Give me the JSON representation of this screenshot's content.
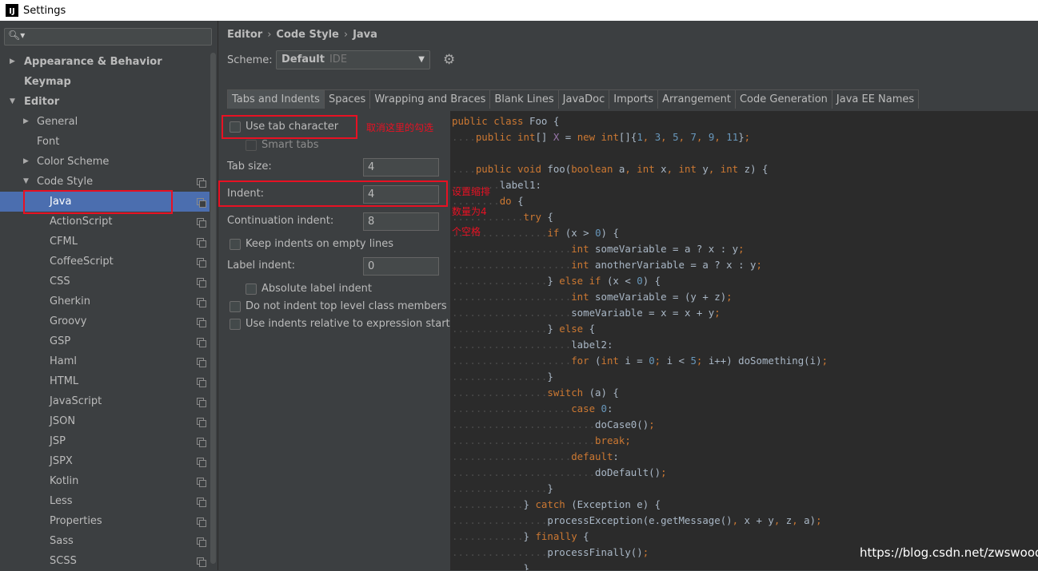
{
  "window": {
    "title": "Settings"
  },
  "search": {
    "placeholder": ""
  },
  "tree": [
    {
      "label": "Appearance & Behavior",
      "arrow": "▶",
      "level": 0,
      "bold": true
    },
    {
      "label": "Keymap",
      "arrow": "",
      "level": 0,
      "bold": true
    },
    {
      "label": "Editor",
      "arrow": "▼",
      "level": 0,
      "bold": true
    },
    {
      "label": "General",
      "arrow": "▶",
      "level": 1
    },
    {
      "label": "Font",
      "arrow": "",
      "level": 1
    },
    {
      "label": "Color Scheme",
      "arrow": "▶",
      "level": 1
    },
    {
      "label": "Code Style",
      "arrow": "▼",
      "level": 1,
      "copy": true
    },
    {
      "label": "Java",
      "arrow": "",
      "level": 2,
      "copy": true,
      "selected": true
    },
    {
      "label": "ActionScript",
      "arrow": "",
      "level": 2,
      "copy": true
    },
    {
      "label": "CFML",
      "arrow": "",
      "level": 2,
      "copy": true
    },
    {
      "label": "CoffeeScript",
      "arrow": "",
      "level": 2,
      "copy": true
    },
    {
      "label": "CSS",
      "arrow": "",
      "level": 2,
      "copy": true
    },
    {
      "label": "Gherkin",
      "arrow": "",
      "level": 2,
      "copy": true
    },
    {
      "label": "Groovy",
      "arrow": "",
      "level": 2,
      "copy": true
    },
    {
      "label": "GSP",
      "arrow": "",
      "level": 2,
      "copy": true
    },
    {
      "label": "Haml",
      "arrow": "",
      "level": 2,
      "copy": true
    },
    {
      "label": "HTML",
      "arrow": "",
      "level": 2,
      "copy": true
    },
    {
      "label": "JavaScript",
      "arrow": "",
      "level": 2,
      "copy": true
    },
    {
      "label": "JSON",
      "arrow": "",
      "level": 2,
      "copy": true
    },
    {
      "label": "JSP",
      "arrow": "",
      "level": 2,
      "copy": true
    },
    {
      "label": "JSPX",
      "arrow": "",
      "level": 2,
      "copy": true
    },
    {
      "label": "Kotlin",
      "arrow": "",
      "level": 2,
      "copy": true
    },
    {
      "label": "Less",
      "arrow": "",
      "level": 2,
      "copy": true
    },
    {
      "label": "Properties",
      "arrow": "",
      "level": 2,
      "copy": true
    },
    {
      "label": "Sass",
      "arrow": "",
      "level": 2,
      "copy": true
    },
    {
      "label": "SCSS",
      "arrow": "",
      "level": 2,
      "copy": true
    }
  ],
  "breadcrumb": {
    "a": "Editor",
    "b": "Code Style",
    "c": "Java",
    "sep": "›"
  },
  "scheme": {
    "label": "Scheme:",
    "name": "Default",
    "sub": "IDE"
  },
  "tabs": [
    "Tabs and Indents",
    "Spaces",
    "Wrapping and Braces",
    "Blank Lines",
    "JavaDoc",
    "Imports",
    "Arrangement",
    "Code Generation",
    "Java EE Names"
  ],
  "options": {
    "use_tab": "Use tab character",
    "smart_tabs": "Smart tabs",
    "tab_size_label": "Tab size:",
    "tab_size": "4",
    "indent_label": "Indent:",
    "indent": "4",
    "cont_label": "Continuation indent:",
    "cont": "8",
    "keep_empty": "Keep indents on empty lines",
    "label_indent_label": "Label indent:",
    "label_indent": "0",
    "abs_label": "Absolute label indent",
    "no_indent_top": "Do not indent top level class members",
    "relative": "Use indents relative to expression start"
  },
  "annotations": {
    "a1": "取消这里的勾选",
    "a2_l1": "设置缩排",
    "a2_l2": "数量为4",
    "a2_l3": "个空格"
  },
  "code": [
    [
      {
        "k": "kw",
        "t": "public class "
      },
      {
        "t": "Foo {"
      }
    ],
    [
      {
        "k": "ws",
        "t": "...."
      },
      {
        "k": "kw",
        "t": "public int"
      },
      {
        "t": "[] "
      },
      {
        "k": "fld",
        "t": "X"
      },
      {
        "t": " = "
      },
      {
        "k": "kw",
        "t": "new int"
      },
      {
        "t": "[]{"
      },
      {
        "k": "num",
        "t": "1"
      },
      {
        "k": "kw",
        "t": ", "
      },
      {
        "k": "num",
        "t": "3"
      },
      {
        "k": "kw",
        "t": ", "
      },
      {
        "k": "num",
        "t": "5"
      },
      {
        "k": "kw",
        "t": ", "
      },
      {
        "k": "num",
        "t": "7"
      },
      {
        "k": "kw",
        "t": ", "
      },
      {
        "k": "num",
        "t": "9"
      },
      {
        "k": "kw",
        "t": ", "
      },
      {
        "k": "num",
        "t": "11"
      },
      {
        "t": "}"
      },
      {
        "k": "kw",
        "t": ";"
      }
    ],
    [
      {
        "t": ""
      }
    ],
    [
      {
        "k": "ws",
        "t": "...."
      },
      {
        "k": "kw",
        "t": "public void "
      },
      {
        "t": "foo("
      },
      {
        "k": "kw",
        "t": "boolean "
      },
      {
        "t": "a"
      },
      {
        "k": "kw",
        "t": ", int "
      },
      {
        "t": "x"
      },
      {
        "k": "kw",
        "t": ", int "
      },
      {
        "t": "y"
      },
      {
        "k": "kw",
        "t": ", int "
      },
      {
        "t": "z) {"
      }
    ],
    [
      {
        "k": "ws",
        "t": "........"
      },
      {
        "t": "label1:"
      }
    ],
    [
      {
        "k": "ws",
        "t": "........"
      },
      {
        "k": "kw",
        "t": "do "
      },
      {
        "t": "{"
      }
    ],
    [
      {
        "k": "ws",
        "t": "............"
      },
      {
        "k": "kw",
        "t": "try "
      },
      {
        "t": "{"
      }
    ],
    [
      {
        "k": "ws",
        "t": "................"
      },
      {
        "k": "kw",
        "t": "if "
      },
      {
        "t": "(x > "
      },
      {
        "k": "num",
        "t": "0"
      },
      {
        "t": ") {"
      }
    ],
    [
      {
        "k": "ws",
        "t": "...................."
      },
      {
        "k": "kw",
        "t": "int "
      },
      {
        "t": "someVariable = a ? x : y"
      },
      {
        "k": "kw",
        "t": ";"
      }
    ],
    [
      {
        "k": "ws",
        "t": "...................."
      },
      {
        "k": "kw",
        "t": "int "
      },
      {
        "t": "anotherVariable = a ? x : y"
      },
      {
        "k": "kw",
        "t": ";"
      }
    ],
    [
      {
        "k": "ws",
        "t": "................"
      },
      {
        "t": "} "
      },
      {
        "k": "kw",
        "t": "else if "
      },
      {
        "t": "(x < "
      },
      {
        "k": "num",
        "t": "0"
      },
      {
        "t": ") {"
      }
    ],
    [
      {
        "k": "ws",
        "t": "...................."
      },
      {
        "k": "kw",
        "t": "int "
      },
      {
        "t": "someVariable = (y + z)"
      },
      {
        "k": "kw",
        "t": ";"
      }
    ],
    [
      {
        "k": "ws",
        "t": "...................."
      },
      {
        "t": "someVariable = x = x + y"
      },
      {
        "k": "kw",
        "t": ";"
      }
    ],
    [
      {
        "k": "ws",
        "t": "................"
      },
      {
        "t": "} "
      },
      {
        "k": "kw",
        "t": "else "
      },
      {
        "t": "{"
      }
    ],
    [
      {
        "k": "ws",
        "t": "...................."
      },
      {
        "t": "label2:"
      }
    ],
    [
      {
        "k": "ws",
        "t": "...................."
      },
      {
        "k": "kw",
        "t": "for "
      },
      {
        "t": "("
      },
      {
        "k": "kw",
        "t": "int "
      },
      {
        "t": "i = "
      },
      {
        "k": "num",
        "t": "0"
      },
      {
        "k": "kw",
        "t": "; "
      },
      {
        "t": "i < "
      },
      {
        "k": "num",
        "t": "5"
      },
      {
        "k": "kw",
        "t": "; "
      },
      {
        "t": "i++) doSomething(i)"
      },
      {
        "k": "kw",
        "t": ";"
      }
    ],
    [
      {
        "k": "ws",
        "t": "................"
      },
      {
        "t": "}"
      }
    ],
    [
      {
        "k": "ws",
        "t": "................"
      },
      {
        "k": "kw",
        "t": "switch "
      },
      {
        "t": "(a) {"
      }
    ],
    [
      {
        "k": "ws",
        "t": "...................."
      },
      {
        "k": "kw",
        "t": "case "
      },
      {
        "k": "num",
        "t": "0"
      },
      {
        "t": ":"
      }
    ],
    [
      {
        "k": "ws",
        "t": "........................"
      },
      {
        "t": "doCase0()"
      },
      {
        "k": "kw",
        "t": ";"
      }
    ],
    [
      {
        "k": "ws",
        "t": "........................"
      },
      {
        "k": "kw",
        "t": "break;"
      }
    ],
    [
      {
        "k": "ws",
        "t": "...................."
      },
      {
        "k": "kw",
        "t": "default"
      },
      {
        "t": ":"
      }
    ],
    [
      {
        "k": "ws",
        "t": "........................"
      },
      {
        "t": "doDefault()"
      },
      {
        "k": "kw",
        "t": ";"
      }
    ],
    [
      {
        "k": "ws",
        "t": "................"
      },
      {
        "t": "}"
      }
    ],
    [
      {
        "k": "ws",
        "t": "............"
      },
      {
        "t": "} "
      },
      {
        "k": "kw",
        "t": "catch "
      },
      {
        "t": "(Exception e) {"
      }
    ],
    [
      {
        "k": "ws",
        "t": "................"
      },
      {
        "t": "processException(e.getMessage()"
      },
      {
        "k": "kw",
        "t": ", "
      },
      {
        "t": "x + y"
      },
      {
        "k": "kw",
        "t": ", "
      },
      {
        "t": "z"
      },
      {
        "k": "kw",
        "t": ", "
      },
      {
        "t": "a)"
      },
      {
        "k": "kw",
        "t": ";"
      }
    ],
    [
      {
        "k": "ws",
        "t": "............"
      },
      {
        "t": "} "
      },
      {
        "k": "kw",
        "t": "finally "
      },
      {
        "t": "{"
      }
    ],
    [
      {
        "k": "ws",
        "t": "................"
      },
      {
        "t": "processFinally()"
      },
      {
        "k": "kw",
        "t": ";"
      }
    ],
    [
      {
        "k": "ws",
        "t": "............"
      },
      {
        "t": "}"
      }
    ]
  ],
  "watermark": "https://blog.csdn.net/zwswood"
}
